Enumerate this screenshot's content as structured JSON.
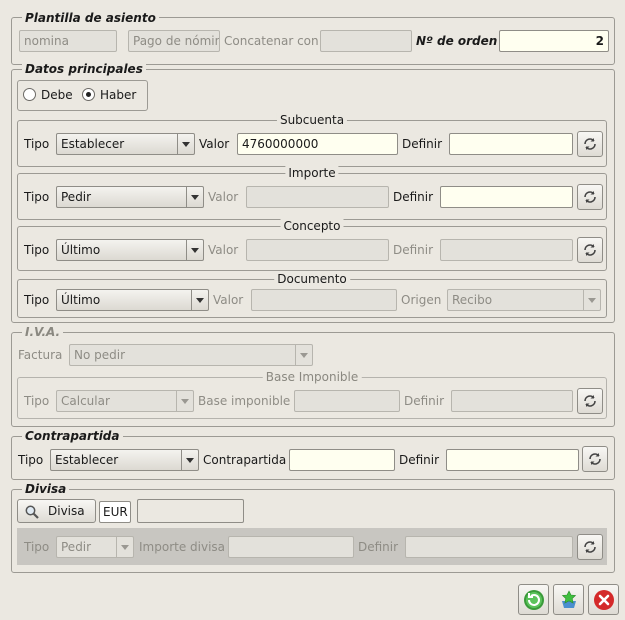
{
  "plantilla": {
    "title": "Plantilla de asiento",
    "nomina_value": "nomina",
    "pago_value": "Pago de nómin",
    "concat_label": "Concatenar con",
    "concat_value": "",
    "orden_label": "Nº de orden",
    "orden_value": "2"
  },
  "datos": {
    "title": "Datos principales",
    "debe_label": "Debe",
    "haber_label": "Haber",
    "selected": "Haber",
    "subcuenta": {
      "title": "Subcuenta",
      "tipo_label": "Tipo",
      "tipo_value": "Establecer",
      "valor_label": "Valor",
      "valor_value": "4760000000",
      "definir_label": "Definir",
      "definir_value": ""
    },
    "importe": {
      "title": "Importe",
      "tipo_label": "Tipo",
      "tipo_value": "Pedir",
      "valor_label": "Valor",
      "valor_value": "",
      "definir_label": "Definir",
      "definir_value": ""
    },
    "concepto": {
      "title": "Concepto",
      "tipo_label": "Tipo",
      "tipo_value": "Último",
      "valor_label": "Valor",
      "valor_value": "",
      "definir_label": "Definir",
      "definir_value": ""
    },
    "documento": {
      "title": "Documento",
      "tipo_label": "Tipo",
      "tipo_value": "Último",
      "valor_label": "Valor",
      "valor_value": "",
      "origen_label": "Origen",
      "origen_value": "Recibo"
    }
  },
  "iva": {
    "title": "I.V.A.",
    "factura_label": "Factura",
    "factura_value": "No pedir",
    "base": {
      "title": "Base Imponible",
      "tipo_label": "Tipo",
      "tipo_value": "Calcular",
      "base_label": "Base imponible",
      "base_value": "",
      "definir_label": "Definir",
      "definir_value": ""
    }
  },
  "contrapartida": {
    "title": "Contrapartida",
    "tipo_label": "Tipo",
    "tipo_value": "Establecer",
    "contra_label": "Contrapartida",
    "contra_value": "",
    "definir_label": "Definir",
    "definir_value": ""
  },
  "divisa": {
    "title": "Divisa",
    "button_label": "Divisa",
    "code_value": "EUR",
    "name_value": "",
    "tipo_label": "Tipo",
    "tipo_value": "Pedir",
    "importe_label": "Importe divisa",
    "importe_value": "",
    "definir_label": "Definir",
    "definir_value": ""
  },
  "icons": {
    "refresh": "refresh-icon",
    "search": "search-icon",
    "ok": "ok-icon",
    "add": "add-icon",
    "cancel": "cancel-icon"
  },
  "colors": {
    "input_bg": "#fffff0",
    "disabled_bg": "#e3e1db",
    "window_bg": "#ebe8e1",
    "ok_green": "#3a9a3a",
    "cancel_red": "#d42a2a"
  }
}
